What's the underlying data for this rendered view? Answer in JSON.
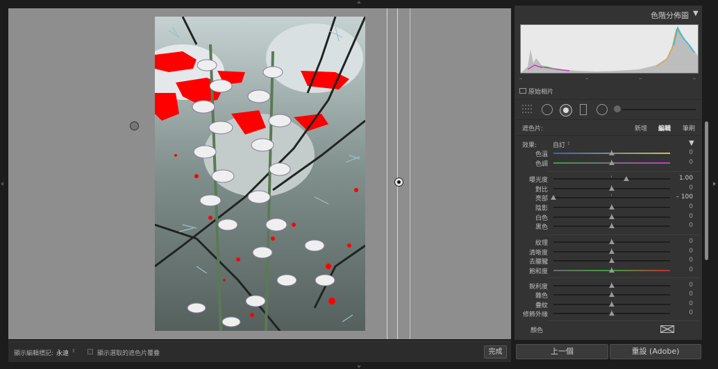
{
  "canvas": {
    "bg_color": "#8e8e8e"
  },
  "toolbar": {
    "show_edit_pins_label": "顯示編輯標記:",
    "show_edit_pins_value": "永遠",
    "show_mask_overlay_label": "顯示選取的遮色片覆疊",
    "done_label": "完成"
  },
  "histogram": {
    "title": "色階分佈圖",
    "collapse_icon": "triangle-down-icon",
    "original_photo_label": "原始相片"
  },
  "tools": {
    "icons": [
      "grid-icon",
      "radial-tool-icon",
      "brush-target-icon",
      "rectangle-icon",
      "circle-icon",
      "size-slider-icon"
    ]
  },
  "mask": {
    "label": "遮色片:",
    "new_label": "新增",
    "edit_label": "編輯",
    "brush_label": "筆刷"
  },
  "effect": {
    "label": "效果:",
    "value": "自訂",
    "menu_icon": "triangle-down-icon"
  },
  "sliders": [
    {
      "name": "temp",
      "label": "色溫",
      "value": "0",
      "pos": 0.5,
      "track": "temp"
    },
    {
      "name": "tint",
      "label": "色調",
      "value": "0",
      "pos": 0.5,
      "track": "tint"
    },
    {
      "name": "exposure",
      "label": "曝光度",
      "value": "1.00",
      "pos": 0.625,
      "track": "plain"
    },
    {
      "name": "contrast",
      "label": "對比",
      "value": "0",
      "pos": 0.5,
      "track": "plain"
    },
    {
      "name": "highlights",
      "label": "亮部",
      "value": "– 100",
      "pos": 0.0,
      "track": "plain"
    },
    {
      "name": "shadows",
      "label": "陰影",
      "value": "0",
      "pos": 0.5,
      "track": "plain"
    },
    {
      "name": "whites",
      "label": "白色",
      "value": "0",
      "pos": 0.5,
      "track": "plain"
    },
    {
      "name": "blacks",
      "label": "黑色",
      "value": "0",
      "pos": 0.5,
      "track": "plain"
    },
    {
      "name": "texture",
      "label": "紋理",
      "value": "0",
      "pos": 0.5,
      "track": "plain"
    },
    {
      "name": "clarity",
      "label": "清晰度",
      "value": "0",
      "pos": 0.5,
      "track": "plain"
    },
    {
      "name": "dehaze",
      "label": "去朦朧",
      "value": "0",
      "pos": 0.5,
      "track": "plain"
    },
    {
      "name": "saturation",
      "label": "飽和度",
      "value": "0",
      "pos": 0.5,
      "track": "sat"
    },
    {
      "name": "sharpness",
      "label": "銳利度",
      "value": "0",
      "pos": 0.5,
      "track": "plain"
    },
    {
      "name": "noise",
      "label": "雜色",
      "value": "0",
      "pos": 0.5,
      "track": "plain"
    },
    {
      "name": "moire",
      "label": "疊紋",
      "value": "0",
      "pos": 0.5,
      "track": "plain"
    },
    {
      "name": "defringe",
      "label": "修飾外緣",
      "value": "0",
      "pos": 0.5,
      "track": "plain"
    }
  ],
  "color": {
    "label": "顏色",
    "swatch_icon": "no-color-swatch-icon"
  },
  "buttons": {
    "previous_label": "上一個",
    "reset_label": "重設 (Adobe)"
  }
}
